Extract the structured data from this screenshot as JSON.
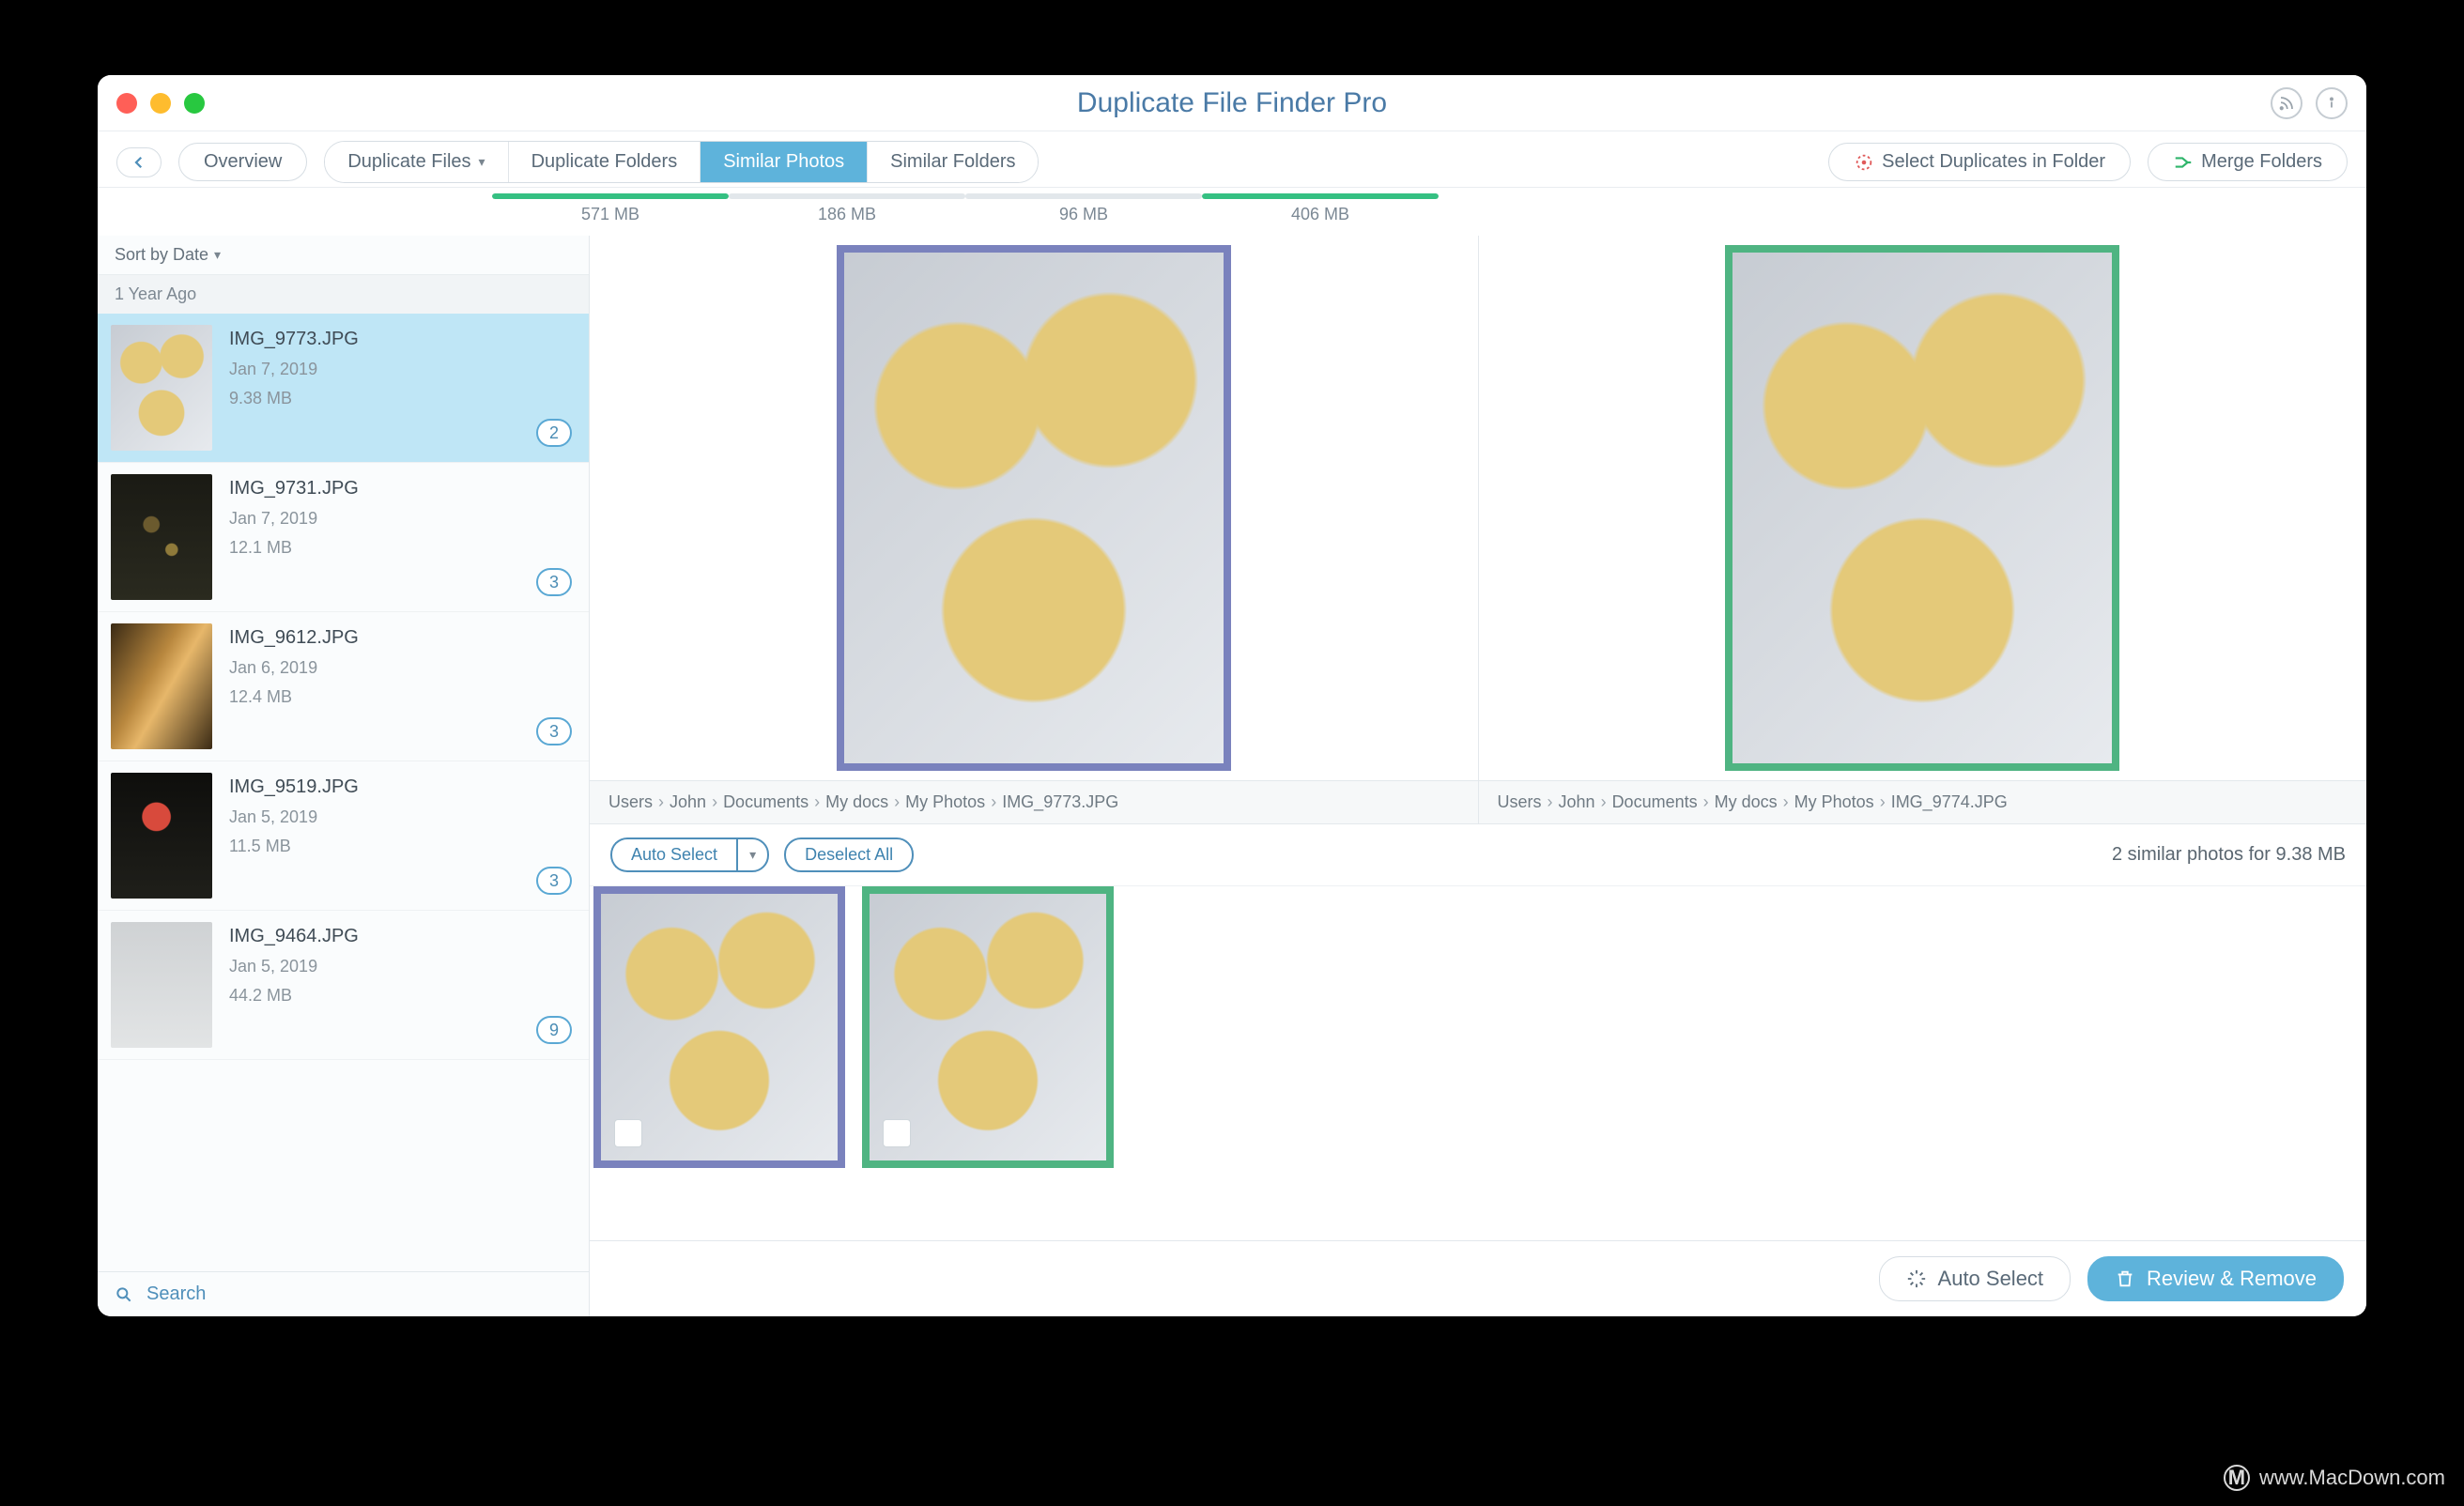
{
  "window": {
    "title": "Duplicate File Finder Pro"
  },
  "toolbar": {
    "overview": "Overview",
    "tabs": {
      "duplicate_files": {
        "label": "Duplicate Files",
        "size": "571 MB",
        "fill_pct": 100,
        "color": "#35c082"
      },
      "duplicate_folders": {
        "label": "Duplicate Folders",
        "size": "186 MB",
        "fill_pct": 0,
        "color": "#35c082"
      },
      "similar_photos": {
        "label": "Similar Photos",
        "size": "96 MB",
        "fill_pct": 0,
        "color": "#35c082"
      },
      "similar_folders": {
        "label": "Similar Folders",
        "size": "406 MB",
        "fill_pct": 100,
        "color": "#35c082"
      }
    },
    "select_in_folder": "Select Duplicates in Folder",
    "merge_folders": "Merge Folders"
  },
  "sidebar": {
    "sort_label": "Sort by Date",
    "group_header": "1 Year Ago",
    "search_label": "Search",
    "items": [
      {
        "name": "IMG_9773.JPG",
        "date": "Jan 7, 2019",
        "size": "9.38 MB",
        "count": "2",
        "selected": true,
        "thumb": "th-a"
      },
      {
        "name": "IMG_9731.JPG",
        "date": "Jan 7, 2019",
        "size": "12.1 MB",
        "count": "3",
        "selected": false,
        "thumb": "th-b"
      },
      {
        "name": "IMG_9612.JPG",
        "date": "Jan 6, 2019",
        "size": "12.4 MB",
        "count": "3",
        "selected": false,
        "thumb": "th-c"
      },
      {
        "name": "IMG_9519.JPG",
        "date": "Jan 5, 2019",
        "size": "11.5 MB",
        "count": "3",
        "selected": false,
        "thumb": "th-d"
      },
      {
        "name": "IMG_9464.JPG",
        "date": "Jan 5, 2019",
        "size": "44.2 MB",
        "count": "9",
        "selected": false,
        "thumb": "th-e"
      }
    ]
  },
  "compare": {
    "left": {
      "border": "purple",
      "path": [
        "Users",
        "John",
        "Documents",
        "My docs",
        "My Photos",
        "IMG_9773.JPG"
      ]
    },
    "right": {
      "border": "green",
      "path": [
        "Users",
        "John",
        "Documents",
        "My docs",
        "My Photos",
        "IMG_9774.JPG"
      ]
    }
  },
  "controls": {
    "auto_select": "Auto Select",
    "deselect_all": "Deselect All",
    "summary": "2 similar photos for 9.38 MB"
  },
  "thumbs": [
    {
      "border": "purple",
      "checked": false
    },
    {
      "border": "green",
      "checked": false
    }
  ],
  "footer": {
    "auto_select": "Auto Select",
    "review_remove": "Review & Remove"
  },
  "watermark": "www.MacDown.com"
}
